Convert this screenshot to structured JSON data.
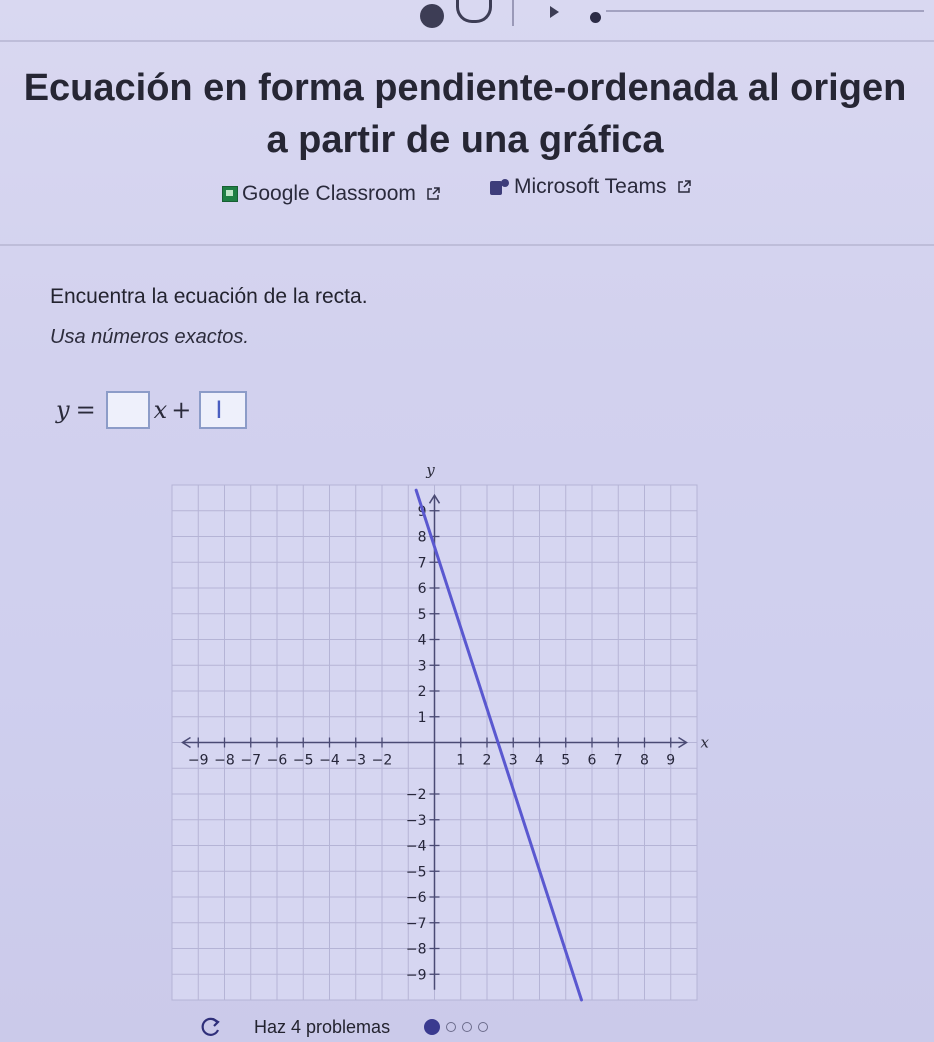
{
  "header": {
    "title": "Ecuación en forma pendiente-ordenada al origen a partir de una gráfica"
  },
  "share": {
    "google_classroom": "Google Classroom",
    "microsoft_teams": "Microsoft Teams"
  },
  "problem": {
    "prompt": "Encuentra la ecuación de la recta.",
    "instruction": "Usa números exactos.",
    "equation": {
      "lhs": "y",
      "equals": "=",
      "x_symbol": "x",
      "plus": "+",
      "slope_value": "",
      "intercept_value": ""
    }
  },
  "graph": {
    "x_axis_label": "x",
    "y_axis_label": "y",
    "x_ticks": [
      "-9",
      "-8",
      "-7",
      "-6",
      "-5",
      "-4",
      "-3",
      "-2",
      "1",
      "2",
      "3",
      "4",
      "5",
      "6",
      "7",
      "8",
      "9"
    ],
    "y_ticks": [
      "9",
      "8",
      "7",
      "6",
      "5",
      "4",
      "3",
      "2",
      "1",
      "-2",
      "-3",
      "-4",
      "-5",
      "-6",
      "-7",
      "-8",
      "-9"
    ]
  },
  "chart_data": {
    "type": "line",
    "xlim": [
      -10,
      10
    ],
    "ylim": [
      -10,
      10
    ],
    "grid": true,
    "xlabel": "x",
    "ylabel": "y",
    "series": [
      {
        "x": [
          -0.7,
          5.6
        ],
        "y": [
          9.8,
          -10
        ]
      }
    ],
    "points_on_line": [
      [
        0,
        7.5
      ],
      [
        2,
        1.5
      ]
    ],
    "line_color": "#5a58d0"
  },
  "footer": {
    "label": "Haz 4 problemas",
    "progress_total": 4,
    "progress_done": 1
  }
}
